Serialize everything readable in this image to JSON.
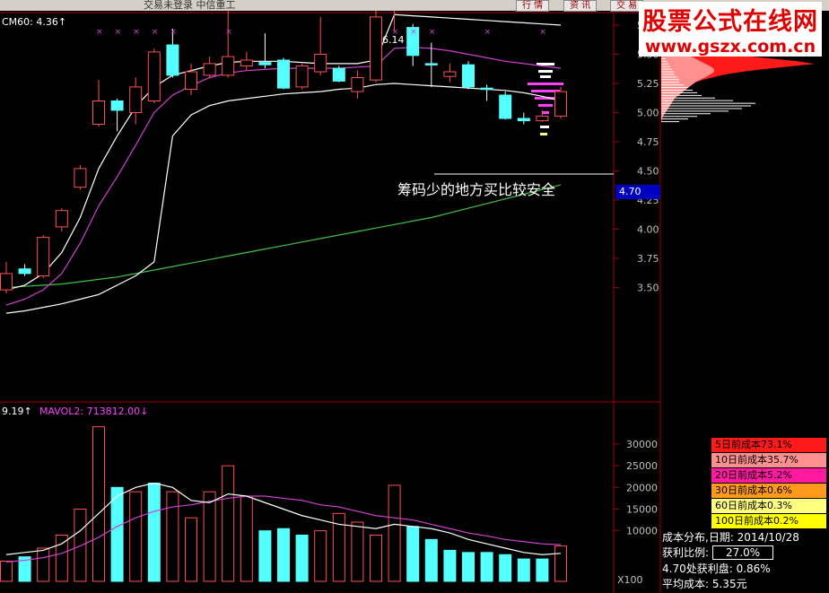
{
  "window": {
    "title_partial": "交易未登录    中信重工",
    "buttons": [
      "行 情",
      "资 讯",
      "交 易"
    ]
  },
  "watermark": {
    "line1": "股票公式在线网",
    "line2": "www.gszx.com.cn"
  },
  "indicators": {
    "cm60": "CM60: 4.36↑",
    "vol_prefix": "9.19↑",
    "mavol2": "MAVOL2: 713812.00↓",
    "high_mark": "6.14",
    "multiplier": "X100"
  },
  "annotation": "筹码少的地方买比较安全",
  "current_price_tag": "4.70",
  "chip_legend": [
    {
      "label": "5日前成本73.1%",
      "color": "#ff1a1a"
    },
    {
      "label": "10日前成本35.7%",
      "color": "#ff9090"
    },
    {
      "label": "20日前成本5.2%",
      "color": "#ff1aa0"
    },
    {
      "label": "30日前成本0.6%",
      "color": "#ff9a1a"
    },
    {
      "label": "60日前成本0.3%",
      "color": "#ffff80"
    },
    {
      "label": "100日前成本0.2%",
      "color": "#ffff00"
    }
  ],
  "chip_info": {
    "title": "成本分布,日期: 2014/10/28",
    "profit_label": "获利比例:",
    "profit_value": "27.0%",
    "profit_at": "4.70处获利盘: 0.86%",
    "avg_cost": "平均成本: 5.35元"
  },
  "chart_data": [
    {
      "type": "candlestick",
      "title": "CM60: 4.36",
      "ylim": [
        3.35,
        6.2
      ],
      "y_ticks": [
        3.5,
        3.75,
        4.0,
        4.25,
        4.5,
        4.75,
        5.0,
        5.25,
        5.5,
        5.75
      ],
      "candles": [
        {
          "o": 3.48,
          "c": 3.62,
          "h": 3.72,
          "l": 3.45
        },
        {
          "o": 3.66,
          "c": 3.62,
          "h": 3.7,
          "l": 3.6
        },
        {
          "o": 3.6,
          "c": 3.93,
          "h": 3.95,
          "l": 3.58
        },
        {
          "o": 4.02,
          "c": 4.16,
          "h": 4.18,
          "l": 3.98
        },
        {
          "o": 4.36,
          "c": 4.52,
          "h": 4.55,
          "l": 4.34
        },
        {
          "o": 4.9,
          "c": 5.1,
          "h": 5.28,
          "l": 4.88
        },
        {
          "o": 5.1,
          "c": 5.02,
          "h": 5.12,
          "l": 4.84
        },
        {
          "o": 5.0,
          "c": 5.22,
          "h": 5.3,
          "l": 4.9
        },
        {
          "o": 5.1,
          "c": 5.52,
          "h": 5.55,
          "l": 5.08
        },
        {
          "o": 5.58,
          "c": 5.32,
          "h": 5.72,
          "l": 5.3
        },
        {
          "o": 5.2,
          "c": 5.35,
          "h": 5.42,
          "l": 5.15
        },
        {
          "o": 5.32,
          "c": 5.42,
          "h": 5.48,
          "l": 5.3
        },
        {
          "o": 5.32,
          "c": 5.48,
          "h": 5.88,
          "l": 5.3
        },
        {
          "o": 5.4,
          "c": 5.45,
          "h": 5.52,
          "l": 5.36
        },
        {
          "o": 5.43,
          "c": 5.41,
          "h": 5.68,
          "l": 5.38
        },
        {
          "o": 5.45,
          "c": 5.21,
          "h": 5.47,
          "l": 5.2
        },
        {
          "o": 5.22,
          "c": 5.4,
          "h": 5.42,
          "l": 5.2
        },
        {
          "o": 5.35,
          "c": 5.5,
          "h": 5.82,
          "l": 5.32
        },
        {
          "o": 5.38,
          "c": 5.27,
          "h": 5.4,
          "l": 5.26
        },
        {
          "o": 5.18,
          "c": 5.3,
          "h": 5.36,
          "l": 5.12
        },
        {
          "o": 5.28,
          "c": 5.82,
          "h": 5.9,
          "l": 5.26
        },
        {
          "o": 5.92,
          "c": 5.97,
          "h": 6.14,
          "l": 5.7
        },
        {
          "o": 5.73,
          "c": 5.49,
          "h": 5.76,
          "l": 5.4
        },
        {
          "o": 5.42,
          "c": 5.41,
          "h": 5.6,
          "l": 5.22
        },
        {
          "o": 5.31,
          "c": 5.35,
          "h": 5.42,
          "l": 5.26
        },
        {
          "o": 5.41,
          "c": 5.22,
          "h": 5.44,
          "l": 5.2
        },
        {
          "o": 5.21,
          "c": 5.2,
          "h": 5.24,
          "l": 5.1
        },
        {
          "o": 5.15,
          "c": 4.95,
          "h": 5.18,
          "l": 4.94
        },
        {
          "o": 4.95,
          "c": 4.93,
          "h": 5.0,
          "l": 4.9
        },
        {
          "o": 4.93,
          "c": 4.97,
          "h": 5.02,
          "l": 4.92
        },
        {
          "o": 4.97,
          "c": 5.18,
          "h": 5.22,
          "l": 4.95
        }
      ],
      "ma_white": [
        3.48,
        3.52,
        3.62,
        3.8,
        4.1,
        4.52,
        4.8,
        5.05,
        5.22,
        5.32,
        5.36,
        5.4,
        5.43,
        5.44,
        5.44,
        5.44,
        5.43,
        5.42,
        5.42,
        5.42,
        5.45,
        5.84,
        5.83,
        5.82,
        5.81,
        5.8,
        5.79,
        5.78,
        5.77,
        5.76,
        5.75
      ],
      "ma_magenta": [
        3.35,
        3.4,
        3.48,
        3.62,
        3.88,
        4.2,
        4.45,
        4.72,
        5.0,
        5.15,
        5.23,
        5.3,
        5.34,
        5.36,
        5.37,
        5.38,
        5.38,
        5.38,
        5.38,
        5.39,
        5.4,
        5.55,
        5.56,
        5.55,
        5.53,
        5.5,
        5.47,
        5.44,
        5.42,
        5.4,
        5.38
      ],
      "ma_white2": [
        3.28,
        3.3,
        3.33,
        3.36,
        3.4,
        3.44,
        3.52,
        3.6,
        3.72,
        4.8,
        4.98,
        5.06,
        5.1,
        5.12,
        5.14,
        5.16,
        5.17,
        5.18,
        5.2,
        5.21,
        5.24,
        5.25,
        5.24,
        5.23,
        5.22,
        5.21,
        5.2,
        5.19,
        5.17,
        5.14,
        5.1
      ],
      "ma_green": [
        3.5,
        3.51,
        3.52,
        3.53,
        3.55,
        3.57,
        3.59,
        3.62,
        3.65,
        3.68,
        3.71,
        3.74,
        3.77,
        3.8,
        3.83,
        3.86,
        3.89,
        3.92,
        3.95,
        3.98,
        4.01,
        4.04,
        4.07,
        4.1,
        4.14,
        4.18,
        4.22,
        4.26,
        4.3,
        4.34,
        4.38
      ]
    },
    {
      "type": "bar",
      "title": "MAVOL2: 713812.00",
      "ylabel": "X100",
      "ylim": [
        0,
        36000
      ],
      "y_ticks": [
        10000,
        15000,
        20000,
        25000,
        30000
      ],
      "values": [
        3000,
        4000,
        6000,
        9000,
        15000,
        34000,
        20000,
        19000,
        21000,
        19000,
        13000,
        19000,
        25000,
        18000,
        10000,
        10500,
        9000,
        10000,
        14000,
        12000,
        9000,
        20500,
        11000,
        8000,
        5500,
        5000,
        5000,
        4500,
        3500,
        3500,
        6500
      ],
      "up": [
        true,
        false,
        true,
        true,
        true,
        true,
        false,
        true,
        false,
        true,
        true,
        true,
        true,
        true,
        false,
        false,
        false,
        true,
        true,
        true,
        true,
        true,
        false,
        false,
        false,
        false,
        false,
        false,
        false,
        false,
        true
      ],
      "mavol1": [
        4500,
        5000,
        5500,
        7000,
        10000,
        14000,
        18000,
        20000,
        21000,
        20000,
        17000,
        16500,
        18500,
        18000,
        16500,
        15000,
        13500,
        12500,
        11500,
        11000,
        10500,
        11500,
        11000,
        10500,
        9500,
        8000,
        7000,
        6000,
        5000,
        4500,
        4800
      ],
      "mavol2": [
        2800,
        3200,
        3800,
        4800,
        6500,
        8500,
        11000,
        13000,
        14500,
        15500,
        16000,
        16800,
        17500,
        18000,
        18000,
        17500,
        17000,
        16000,
        15500,
        14500,
        13500,
        13000,
        12500,
        11500,
        10500,
        9500,
        8800,
        8000,
        7500,
        7000,
        6800
      ]
    }
  ],
  "chip_distribution": {
    "price_range": [
      4.9,
      5.8
    ],
    "red": [
      0,
      0,
      0,
      0,
      0,
      2,
      3,
      5,
      8,
      10,
      12,
      14,
      18,
      22,
      26,
      32,
      40,
      50,
      62,
      76,
      95,
      120,
      150,
      180,
      160,
      130,
      100,
      80,
      60,
      45,
      35,
      28,
      20,
      14,
      10,
      8,
      6,
      4,
      3,
      2,
      1
    ],
    "pink": [
      0,
      0,
      1,
      2,
      4,
      6,
      8,
      10,
      12,
      14,
      16,
      20,
      24,
      28,
      32,
      36,
      40,
      46,
      52,
      58,
      62,
      62,
      58,
      52,
      46,
      40,
      34,
      28,
      22,
      18,
      14,
      10,
      8,
      6,
      4,
      3,
      2,
      1,
      1,
      0,
      0
    ],
    "white": [
      0,
      20,
      30,
      40,
      55,
      75,
      90,
      100,
      105,
      80,
      60,
      45,
      40,
      35,
      30,
      25,
      20,
      20,
      18,
      15,
      14,
      12,
      10,
      8,
      6,
      5,
      4,
      3,
      2,
      2,
      1,
      1,
      0,
      0,
      0,
      0,
      0,
      0,
      0,
      0,
      0
    ]
  }
}
